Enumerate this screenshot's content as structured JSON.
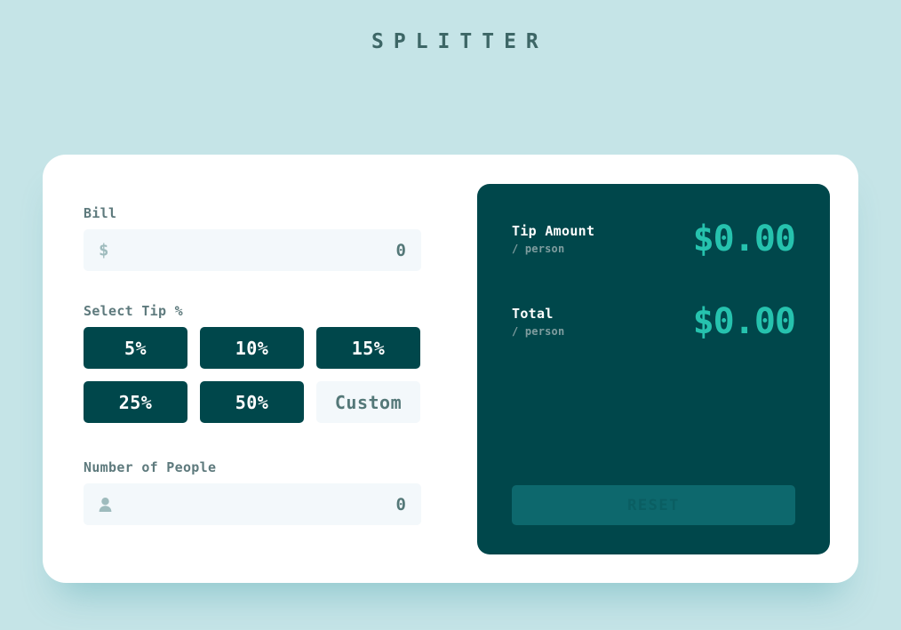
{
  "app": {
    "title": "SPLITTER",
    "title_line1": "SPLI",
    "title_line2": "TTER"
  },
  "colors": {
    "background": "#c5e4e7",
    "card": "#ffffff",
    "dark_panel": "#00474b",
    "accent": "#26c2ae",
    "input_bg": "#f3f8fb",
    "label": "#5e7a7d",
    "value": "#547878",
    "muted": "#7f9d9f",
    "reset_bg": "#0d686d",
    "reset_text": "#0a5e62"
  },
  "bill": {
    "label": "Bill",
    "icon": "dollar-icon",
    "value": "0",
    "placeholder": "0"
  },
  "tip": {
    "label": "Select Tip %",
    "options": [
      {
        "label": "5%",
        "value": 5,
        "selected": false
      },
      {
        "label": "10%",
        "value": 10,
        "selected": false
      },
      {
        "label": "15%",
        "value": 15,
        "selected": false
      },
      {
        "label": "25%",
        "value": 25,
        "selected": false
      },
      {
        "label": "50%",
        "value": 50,
        "selected": false
      }
    ],
    "custom": {
      "value": "Custom",
      "placeholder": "Custom"
    }
  },
  "people": {
    "label": "Number of People",
    "icon": "person-icon",
    "value": "0",
    "placeholder": "0"
  },
  "results": {
    "tip_amount": {
      "title": "Tip Amount",
      "sub": "/ person",
      "value": "$0.00"
    },
    "total": {
      "title": "Total",
      "sub": "/ person",
      "value": "$0.00"
    },
    "reset_label": "RESET",
    "reset_disabled": true
  }
}
